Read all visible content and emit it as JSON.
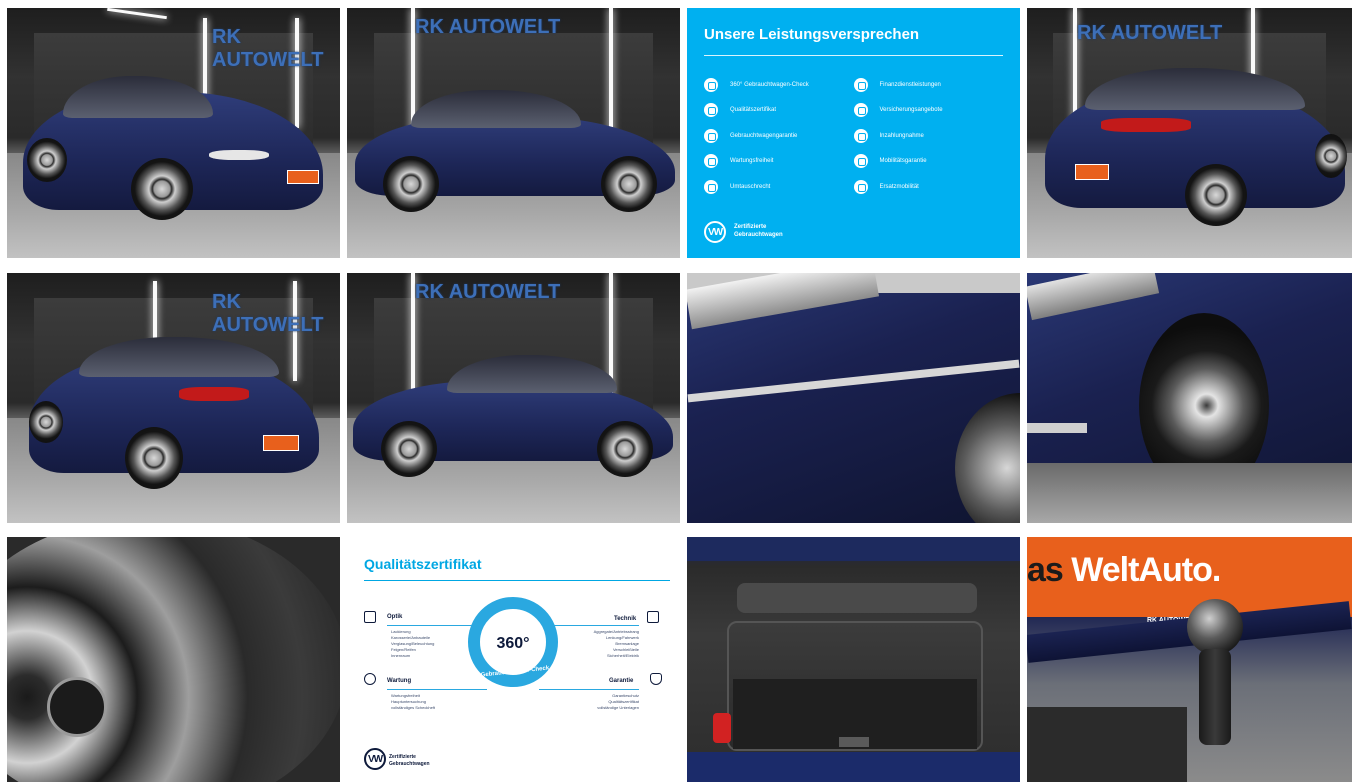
{
  "gallery": {
    "showroom_logo": "RK AUTOWELT",
    "plate_text": "Welt",
    "info_card": {
      "title": "Unsere Leistungsversprechen",
      "left_items": [
        "360° Gebrauchtwagen-Check",
        "Qualitätszertifikat",
        "Gebrauchtwagengarantie",
        "Wartungsfreiheit",
        "Umtauschrecht"
      ],
      "right_items": [
        "Finanzdienstleistungen",
        "Versicherungsangebote",
        "Inzahlungnahme",
        "Mobilitätsgarantie",
        "Ersatzmobilität"
      ],
      "footer_line1": "Zertifizierte",
      "footer_line2": "Gebrauchtwagen",
      "badge": "VW"
    },
    "cert_card": {
      "title": "Qualitätszertifikat",
      "circle_label": "360°",
      "circle_sub": "Gebrauchtwagen-Check",
      "optik_head": "Optik",
      "optik_items": [
        "Lackierung",
        "Karosserie/Anbauteile",
        "Verglasung/Beleuchtung",
        "Felgen/Reifen",
        "Innenraum"
      ],
      "technik_head": "Technik",
      "technik_items": [
        "Aggregate/Antriebsstrang",
        "Lenkung/Fahrwerk",
        "Bremsanlage",
        "Verschleißteile",
        "Sicherheit/Elektrik"
      ],
      "wartung_head": "Wartung",
      "wartung_items": [
        "Wartungsfreiheit",
        "Hauptuntersuchung",
        "vollständiges Scheckheft"
      ],
      "garantie_head": "Garantie",
      "garantie_items": [
        "Garantieschutz",
        "Qualitätszertifikat",
        "vollständige Unterlagen"
      ],
      "footer_line1": "Zertifizierte",
      "footer_line2": "Gebrauchtwagen",
      "badge": "VW"
    },
    "banner": {
      "part1": "as ",
      "part2": "Welt",
      "part3": "Auto.",
      "small_logo": "RK AUTOWELT"
    }
  },
  "colors": {
    "car_blue": "#1d2657",
    "info_blue": "#00b0f0",
    "accent_orange": "#e8601c"
  }
}
